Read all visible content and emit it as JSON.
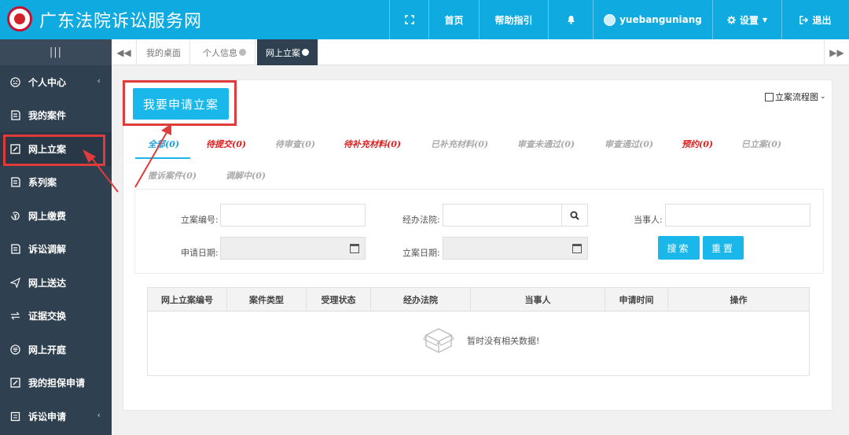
{
  "header": {
    "title": "广东法院诉讼服务网",
    "nav": [
      {
        "label": "",
        "icon": "fullscreen-icon"
      },
      {
        "label": "首页"
      },
      {
        "label": "帮助指引"
      },
      {
        "label": "",
        "icon": "bell-icon"
      },
      {
        "label": "yuebanguniang",
        "icon": "user-avatar"
      },
      {
        "label": "设置",
        "icon": "gear-icon"
      },
      {
        "label": "退出",
        "icon": "logout-icon"
      }
    ]
  },
  "sidebar": {
    "toggle": "|||",
    "items": [
      {
        "label": "个人中心",
        "icon": "smiley-icon",
        "has_arrow": true
      },
      {
        "label": "我的案件",
        "icon": "document-icon"
      },
      {
        "label": "网上立案",
        "icon": "edit-icon",
        "active": true
      },
      {
        "label": "系列案",
        "icon": "document-icon"
      },
      {
        "label": "网上缴费",
        "icon": "payment-icon"
      },
      {
        "label": "诉讼调解",
        "icon": "document-icon"
      },
      {
        "label": "网上送达",
        "icon": "send-icon"
      },
      {
        "label": "证据交换",
        "icon": "exchange-icon"
      },
      {
        "label": "网上开庭",
        "icon": "court-icon"
      },
      {
        "label": "我的担保申请",
        "icon": "edit-icon"
      },
      {
        "label": "诉讼申请",
        "icon": "form-icon",
        "has_arrow": true
      }
    ]
  },
  "tabs": [
    {
      "label": "我的桌面"
    },
    {
      "label": "个人信息"
    },
    {
      "label": "网上立案",
      "active": true
    }
  ],
  "main": {
    "apply_button": "我要申请立案",
    "flow_link": "立案流程图",
    "status_tabs": [
      {
        "label": "全部(0)",
        "style": "blue"
      },
      {
        "label": "待提交(0)",
        "style": "red"
      },
      {
        "label": "待审查(0)",
        "style": "gray"
      },
      {
        "label": "待补充材料(0)",
        "style": "red"
      },
      {
        "label": "已补充材料(0)",
        "style": "gray"
      },
      {
        "label": "审查未通过(0)",
        "style": "gray"
      },
      {
        "label": "审查通过(0)",
        "style": "gray"
      },
      {
        "label": "预约(0)",
        "style": "red"
      },
      {
        "label": "已立案(0)",
        "style": "gray"
      },
      {
        "label": "撤诉案件(0)",
        "style": "gray"
      },
      {
        "label": "调解中(0)",
        "style": "gray"
      }
    ],
    "search": {
      "case_no_label": "立案编号:",
      "court_label": "经办法院:",
      "party_label": "当事人:",
      "apply_date_label": "申请日期:",
      "filing_date_label": "立案日期:",
      "search_button": "搜索",
      "reset_button": "重置"
    },
    "table": {
      "columns": [
        "网上立案编号",
        "案件类型",
        "受理状态",
        "经办法院",
        "当事人",
        "申请时间",
        "操作"
      ],
      "empty_text": "暂时没有相关数据!"
    }
  },
  "colors": {
    "header_bg": "#0faadf",
    "sidebar_bg": "#2f4050",
    "accent": "#1ab7ea",
    "highlight_red": "#e03b3b"
  }
}
